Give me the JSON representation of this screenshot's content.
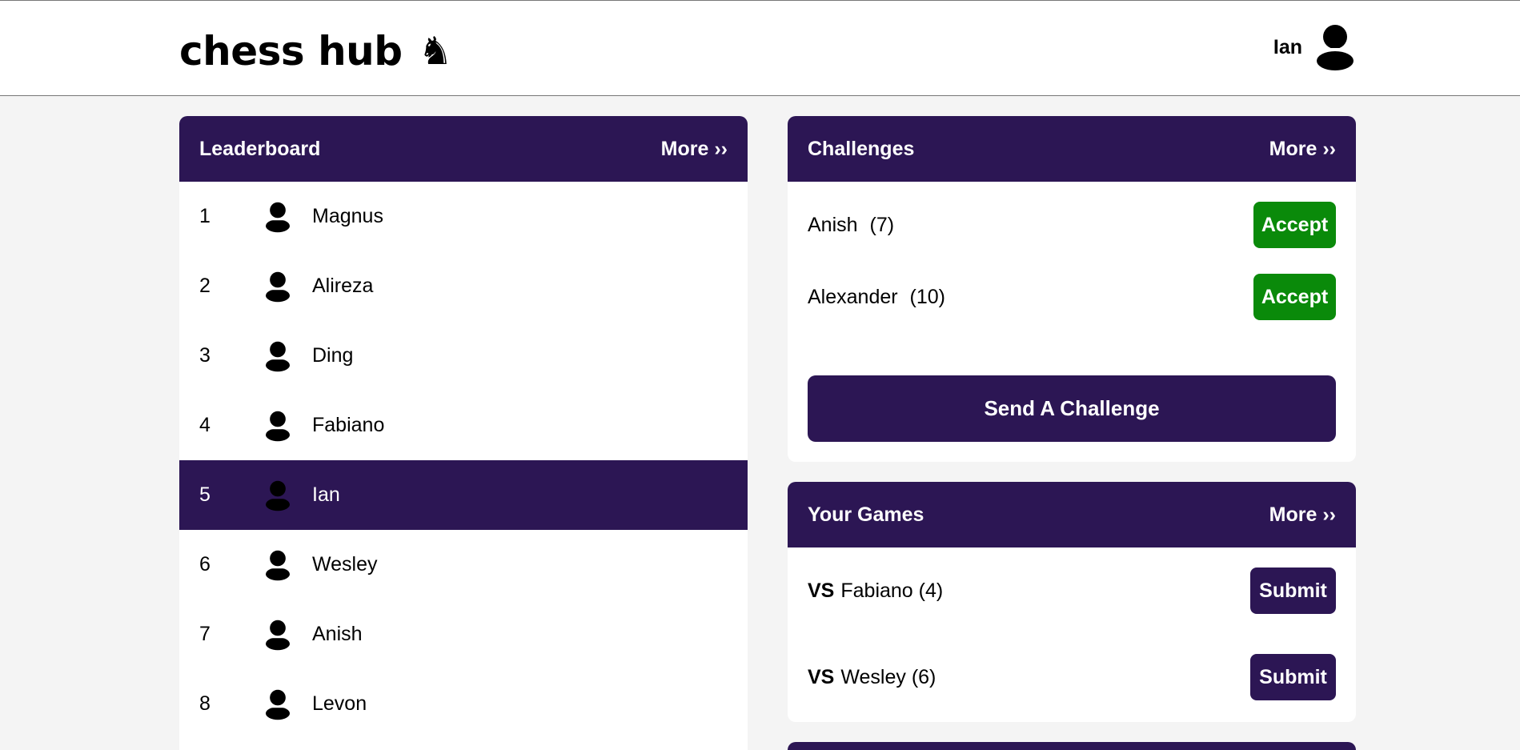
{
  "header": {
    "brand": "chess hub",
    "brand_icon": "♞",
    "username": "Ian"
  },
  "colors": {
    "primary": "#2c1654",
    "accept": "#0a8a0a",
    "background": "#f4f4f4"
  },
  "leaderboard": {
    "title": "Leaderboard",
    "more": "More ››",
    "current_user_rank": 5,
    "rows": [
      {
        "rank": "1",
        "name": "Magnus"
      },
      {
        "rank": "2",
        "name": "Alireza"
      },
      {
        "rank": "3",
        "name": "Ding"
      },
      {
        "rank": "4",
        "name": "Fabiano"
      },
      {
        "rank": "5",
        "name": "Ian"
      },
      {
        "rank": "6",
        "name": "Wesley"
      },
      {
        "rank": "7",
        "name": "Anish"
      },
      {
        "rank": "8",
        "name": "Levon"
      }
    ]
  },
  "challenges": {
    "title": "Challenges",
    "more": "More ››",
    "items": [
      {
        "name": "Anish",
        "rating": "(7)",
        "action": "Accept"
      },
      {
        "name": "Alexander",
        "rating": "(10)",
        "action": "Accept"
      }
    ],
    "send_label": "Send A Challenge"
  },
  "your_games": {
    "title": "Your Games",
    "more": "More ››",
    "vs_label": "VS",
    "items": [
      {
        "opponent": "Fabiano",
        "rating": "(4)",
        "action": "Submit"
      },
      {
        "opponent": "Wesley",
        "rating": "(6)",
        "action": "Submit"
      }
    ]
  }
}
